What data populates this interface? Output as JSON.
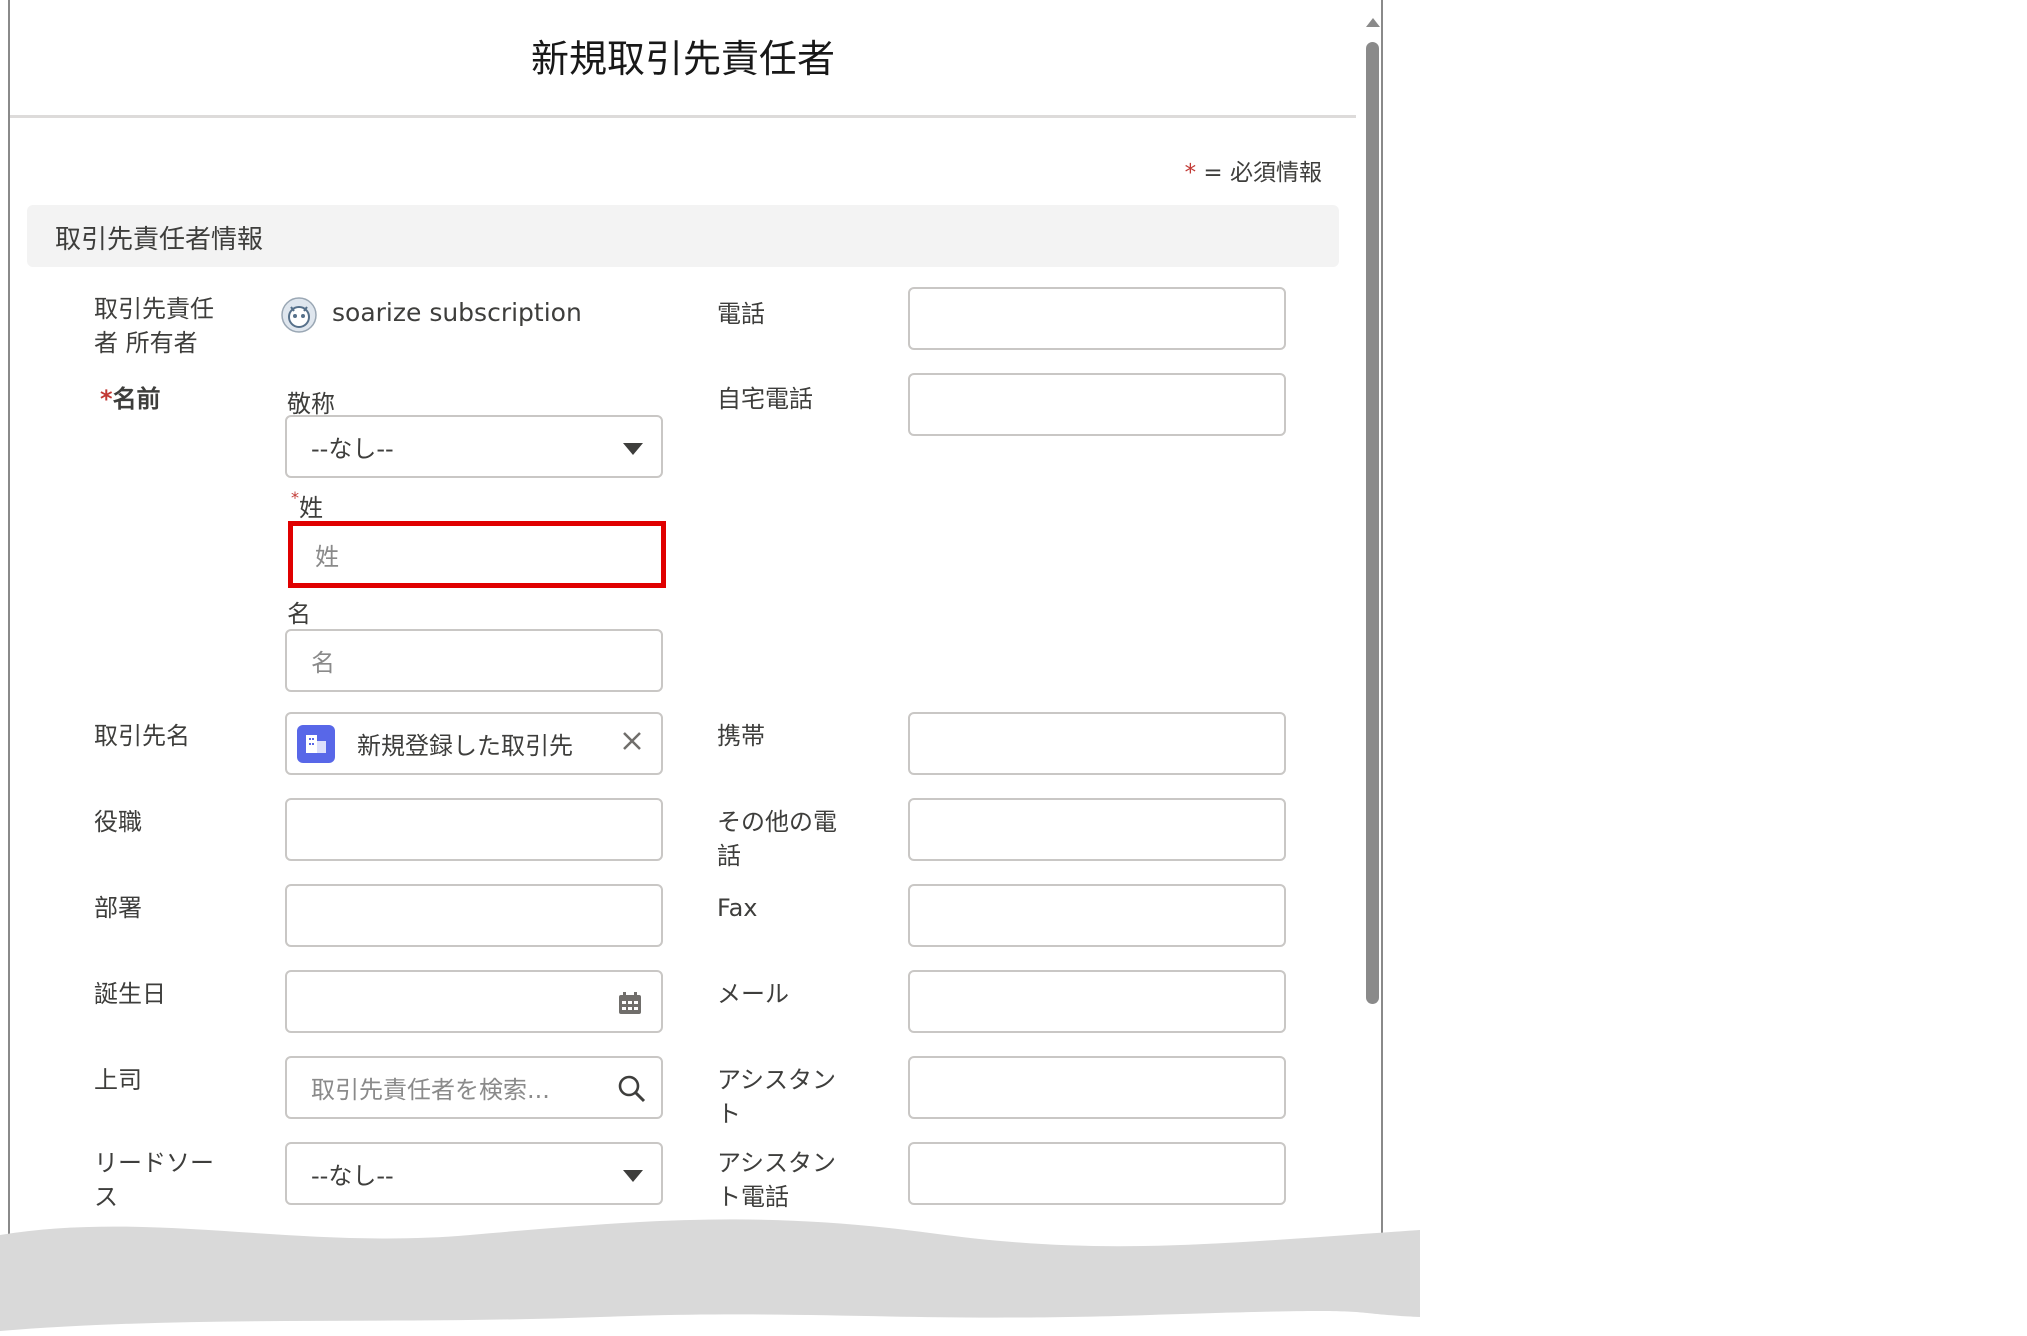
{
  "modal": {
    "title": "新規取引先責任者",
    "required_legend": {
      "star": "*",
      "text": "= 必須情報"
    },
    "section_title": "取引先責任者情報"
  },
  "left_fields": {
    "owner": {
      "label": "取引先責任\n者 所有者",
      "value": "soarize subscription"
    },
    "name": {
      "label_star": "*",
      "label": "名前",
      "salutation": {
        "label": "敬称",
        "value": "--なし--"
      },
      "last_name": {
        "label_star": "*",
        "label": "姓",
        "placeholder": "姓"
      },
      "first_name": {
        "label": "名",
        "placeholder": "名"
      }
    },
    "account": {
      "label": "取引先名",
      "value": "新規登録した取引先"
    },
    "title": {
      "label": "役職",
      "value": ""
    },
    "department": {
      "label": "部署",
      "value": ""
    },
    "birthdate": {
      "label": "誕生日",
      "value": ""
    },
    "reports_to": {
      "label": "上司",
      "placeholder": "取引先責任者を検索..."
    },
    "lead_source": {
      "label": "リードソー\nス",
      "value": "--なし--"
    }
  },
  "right_fields": [
    {
      "label": "電話",
      "value": ""
    },
    {
      "label": "自宅電話",
      "value": ""
    },
    {
      "label": "携帯",
      "value": ""
    },
    {
      "label": "その他の電\n話",
      "value": ""
    },
    {
      "label": "Fax",
      "value": ""
    },
    {
      "label": "メール",
      "value": ""
    },
    {
      "label": "アシスタン\nト",
      "value": ""
    },
    {
      "label": "アシスタン\nト電話",
      "value": ""
    }
  ],
  "icons": {
    "owner_avatar": "robot-avatar-icon",
    "account_icon": "account-building-icon",
    "clear": "close-icon",
    "calendar": "calendar-icon",
    "search": "search-icon",
    "dropdown": "chevron-down-icon"
  },
  "colors": {
    "required": "#c23934",
    "highlight": "#e00000",
    "account_icon_bg": "#5867e8",
    "section_bg": "#f3f3f3"
  }
}
